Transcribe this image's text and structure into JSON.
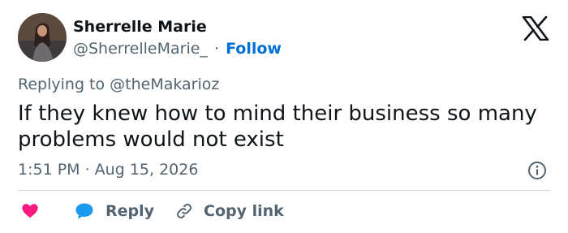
{
  "author": {
    "display_name": "Sherrelle Marie",
    "handle": "@SherrelleMarie_",
    "separator": "·",
    "follow_label": "Follow"
  },
  "reply_context": "Replying to @theMakarioz",
  "tweet_text": "If they knew how to mind their business so many problems would not exist",
  "timestamp": "1:51 PM · Aug 15, 2026",
  "actions": {
    "reply_label": "Reply",
    "copy_link_label": "Copy link"
  },
  "icons": {
    "logo": "x-logo-icon",
    "info": "info-icon",
    "like": "heart-icon",
    "reply": "speech-bubble-icon",
    "copy": "link-icon"
  },
  "colors": {
    "follow": "#006fd6",
    "heart": "#f91880",
    "reply_bubble": "#1d9bf0",
    "secondary_text": "#536471",
    "divider": "#cfd9de"
  }
}
